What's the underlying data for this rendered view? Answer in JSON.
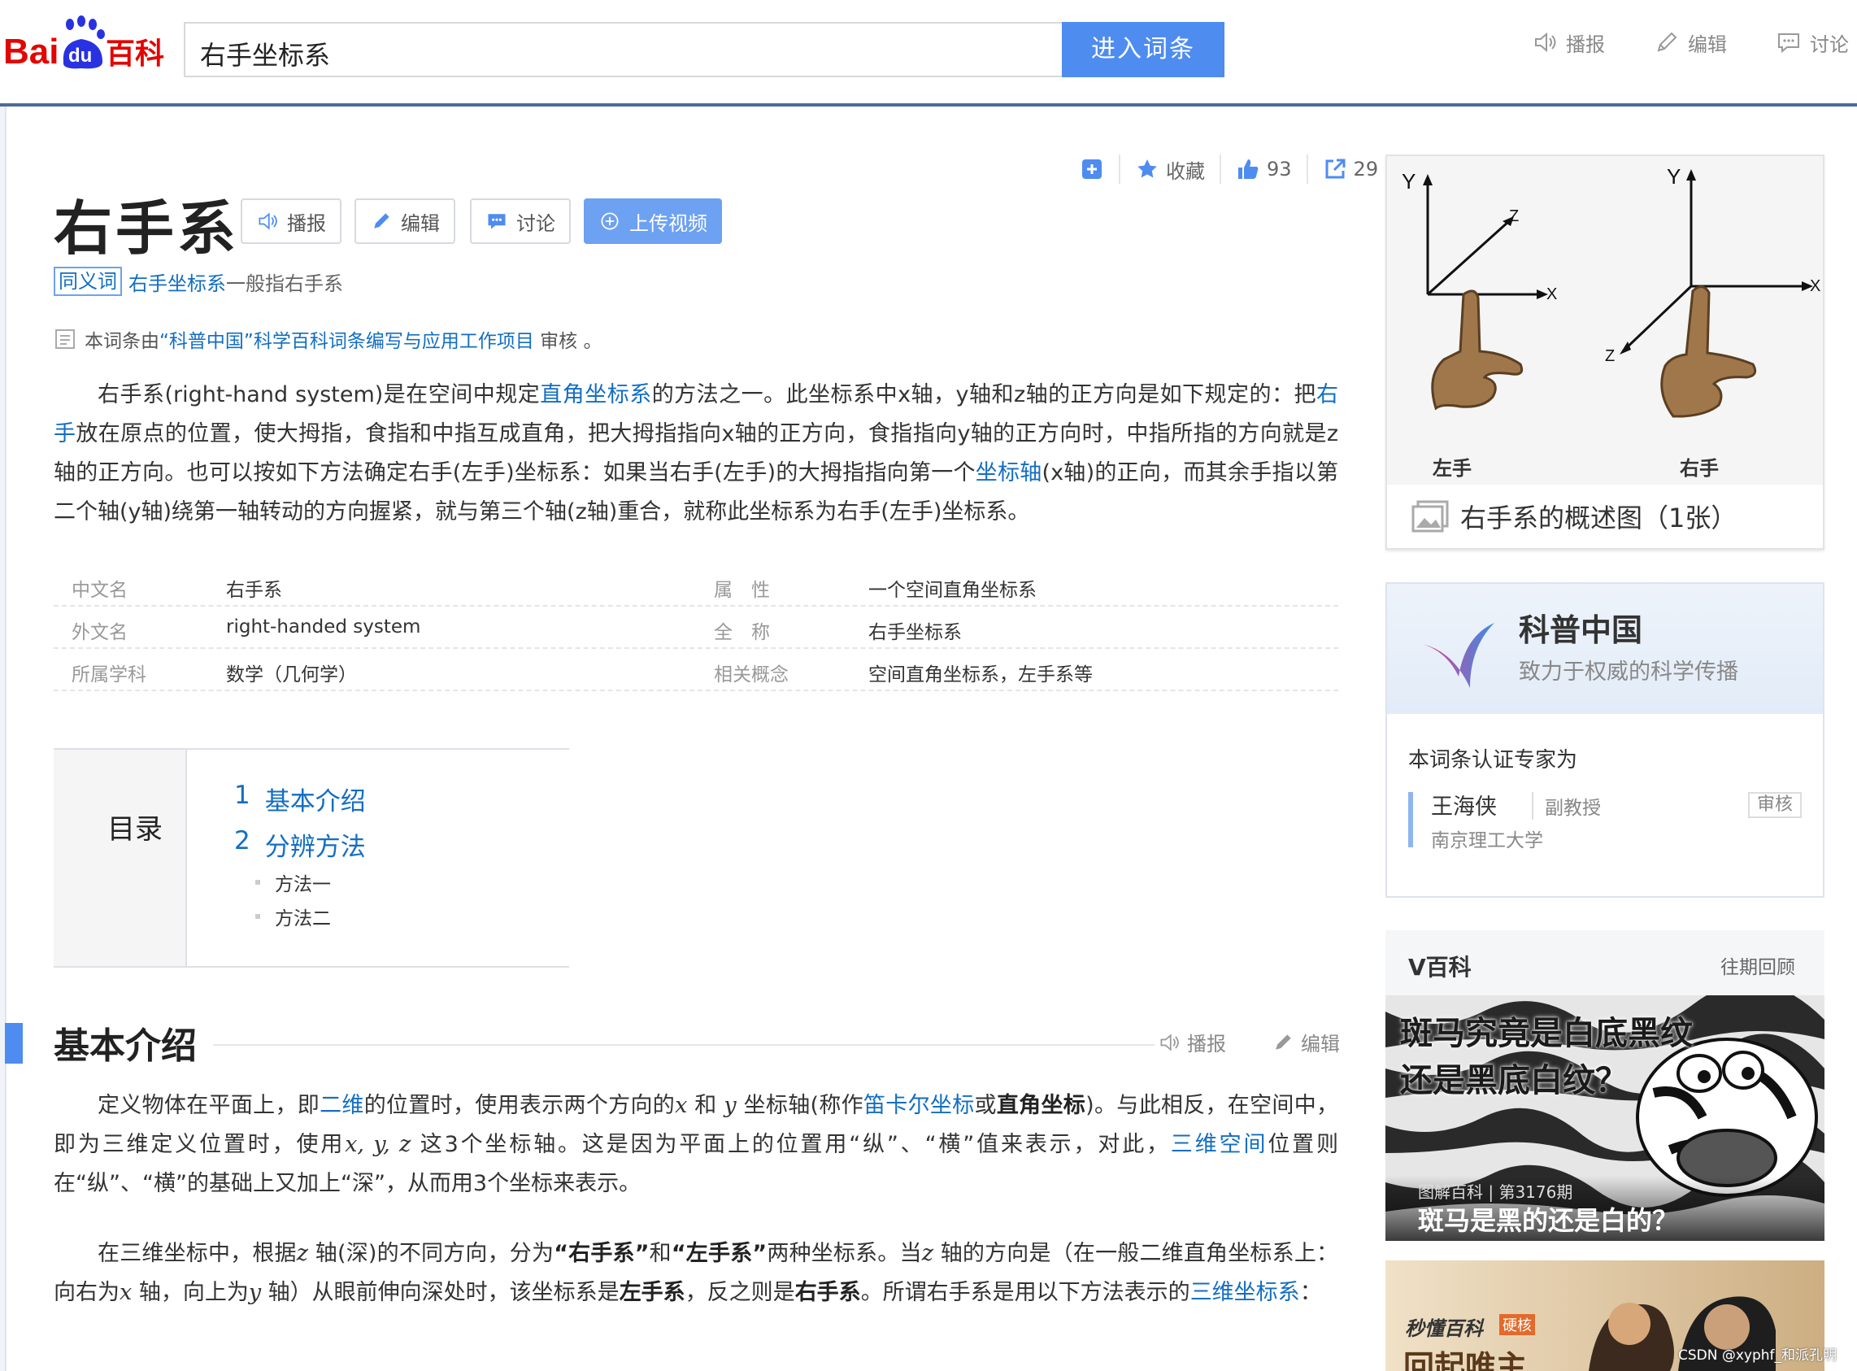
{
  "header": {
    "logo": {
      "part1": "Bai",
      "paw_text": "du",
      "part2": "百科"
    },
    "search_value": "右手坐标系",
    "search_button": "进入词条",
    "tools": [
      {
        "label": "播报",
        "icon": "speaker-icon"
      },
      {
        "label": "编辑",
        "icon": "pencil-icon"
      },
      {
        "label": "讨论",
        "icon": "comment-icon"
      }
    ]
  },
  "lemma": {
    "title": "右手系",
    "buttons": {
      "broadcast": "播报",
      "edit": "编辑",
      "discuss": "讨论",
      "upload_video": "上传视频"
    },
    "meta": {
      "favorite": "收藏",
      "likes": "93",
      "shares": "29"
    },
    "synonym": {
      "tag": "同义词",
      "term": "右手坐标系",
      "note": "一般指右手系"
    },
    "review": {
      "prefix": "本词条由",
      "project": "“科普中国”科学百科词条编写与应用工作项目",
      "suffix": " 审核 。"
    },
    "summary": {
      "t1": "右手系(right-hand system)是在空间中规定",
      "l1": "直角坐标系",
      "t2": "的方法之一。此坐标系中x轴，y轴和z轴的正方向是如下规定的：把",
      "l2": "右手",
      "t3": "放在原点的位置，使大拇指，食指和中指互成直角，把大拇指指向x轴的正方向，食指指向y轴的正方向时，中指所指的方向就是z轴的正方向。也可以按如下方法确定右手(左手)坐标系：如果当右手(左手)的大拇指指向第一个",
      "l3": "坐标轴",
      "t4": "(x轴)的正向，而其余手指以第二个轴(y轴)绕第一轴转动的方向握紧，就与第三个轴(z轴)重合，就称此坐标系为右手(左手)坐标系。"
    }
  },
  "basic_info": [
    {
      "k1": "中文名",
      "v1": "右手系",
      "k2": "属　性",
      "v2": "一个空间直角坐标系"
    },
    {
      "k1": "外文名",
      "v1": "right-handed system",
      "k2": "全　称",
      "v2": "右手坐标系"
    },
    {
      "k1": "所属学科",
      "v1": "数学（几何学）",
      "k2": "相关概念",
      "v2": "空间直角坐标系，左手系等"
    }
  ],
  "catalog": {
    "label": "目录",
    "items": [
      {
        "num": "1",
        "text": "基本介绍"
      },
      {
        "num": "2",
        "text": "分辨方法"
      }
    ],
    "sub_items": [
      "方法一",
      "方法二"
    ]
  },
  "section1": {
    "title": "基本介绍",
    "broadcast": "播报",
    "edit": "编辑",
    "p1": {
      "a": "定义物体在平面上，即",
      "l1": "二维",
      "b": "的位置时，使用表示两个方向的",
      "x": "x",
      "c": " 和 ",
      "y": "y",
      "d": " 坐标轴(称作",
      "l2": "笛卡尔坐标",
      "e": "或",
      "f": "直角坐标",
      "g": ")。与此相反，在空间中，即为三维定义位置时，使用",
      "xyz": "x, y, z",
      "h": " 这3个坐标轴。这是因为平面上的位置用“纵”、“横”值来表示，对此，",
      "l3": "三维空间",
      "i": "位置则在“纵”、“横”的基础上又加上“深”，从而用3个坐标来表示。"
    },
    "p2": {
      "a": "在三维坐标中，根据",
      "z1": "z",
      "b": " 轴(深)的不同方向，分为",
      "c": "“右手系”",
      "d": "和",
      "e": "“左手系”",
      "f": "两种坐标系。当",
      "z2": "z",
      "g": " 轴的方向是（在一般二维直角坐标系上：向右为",
      "x": "x",
      "h": " 轴，向上为",
      "y": "y",
      "i": " 轴）从眼前伸向深处时，该坐标系是",
      "j": "左手系",
      "k": "，反之则是",
      "l": "右手系",
      "m": "。所谓右手系是用以下方法表示的",
      "link": "三维坐标系",
      "n": "："
    }
  },
  "album": {
    "labels": {
      "y1": "Y",
      "z1": "Z",
      "x1": "X",
      "y2": "Y",
      "z2": "Z",
      "x2": "X",
      "left_hand": "左手",
      "right_hand": "右手"
    },
    "caption": "右手系的概述图（1张）"
  },
  "kepu": {
    "org": "科普中国",
    "slogan": "致力于权威的科学传播",
    "cert": "本词条认证专家为",
    "expert": "王海侠",
    "rank": "副教授",
    "school": "南京理工大学",
    "audit": "审核"
  },
  "vbaike": {
    "name": "V百科",
    "more": "往期回顾",
    "poster_title1": "斑马究竟是白底黑纹",
    "poster_title2": "还是黑底白纹？",
    "poster_meta": "图解百科 | 第3176期",
    "poster_sub": "斑马是黑的还是白的？",
    "poster2_logo": "秒懂百科",
    "poster2_tag": "硬核",
    "poster2_big": "回起唯主"
  },
  "watermark": "CSDN @xyphf_和派孔明",
  "colors": {
    "brand_red": "#e10602",
    "brand_blue": "#2932e1",
    "link": "#136ec2",
    "button_blue": "#4e8cf0"
  }
}
